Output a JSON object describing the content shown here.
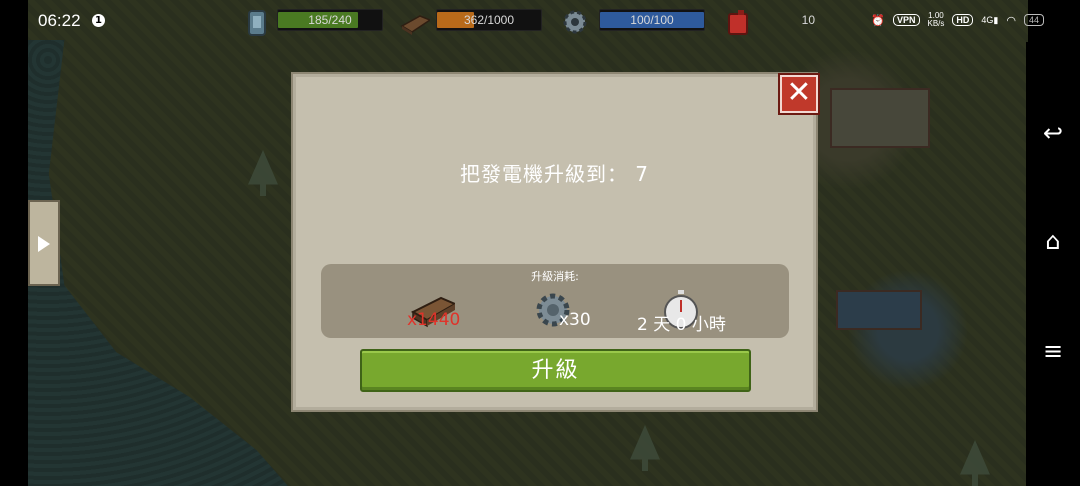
{
  "status_bar": {
    "time": "06:22",
    "notification_count": "1",
    "network_speed": "1.00\nKB/s",
    "vpn_label": "VPN",
    "hd_label": "HD",
    "signal_label": "4G",
    "battery": "44"
  },
  "resources": {
    "water": {
      "text": "185/240",
      "fill": 0.77,
      "color": "#4a7a22"
    },
    "wood": {
      "text": "362/1000",
      "fill": 0.36,
      "color": "#b86a1a"
    },
    "gears": {
      "text": "100/100",
      "fill": 1.0,
      "color": "#2e5a9c"
    },
    "fuel": {
      "text": "10",
      "fill": 0.0,
      "color": "#b82a2a"
    }
  },
  "dialog": {
    "title": "把發電機升級到：  7",
    "close_label": "✕",
    "cost_title": "升級消耗:",
    "costs": {
      "wood": "x1440",
      "gears": "x30",
      "time": "2 天 0 小時"
    },
    "upgrade_label": "升級"
  },
  "nav": {
    "back_icon": "↩",
    "home_icon": "⌂",
    "menu_icon": "≡"
  }
}
